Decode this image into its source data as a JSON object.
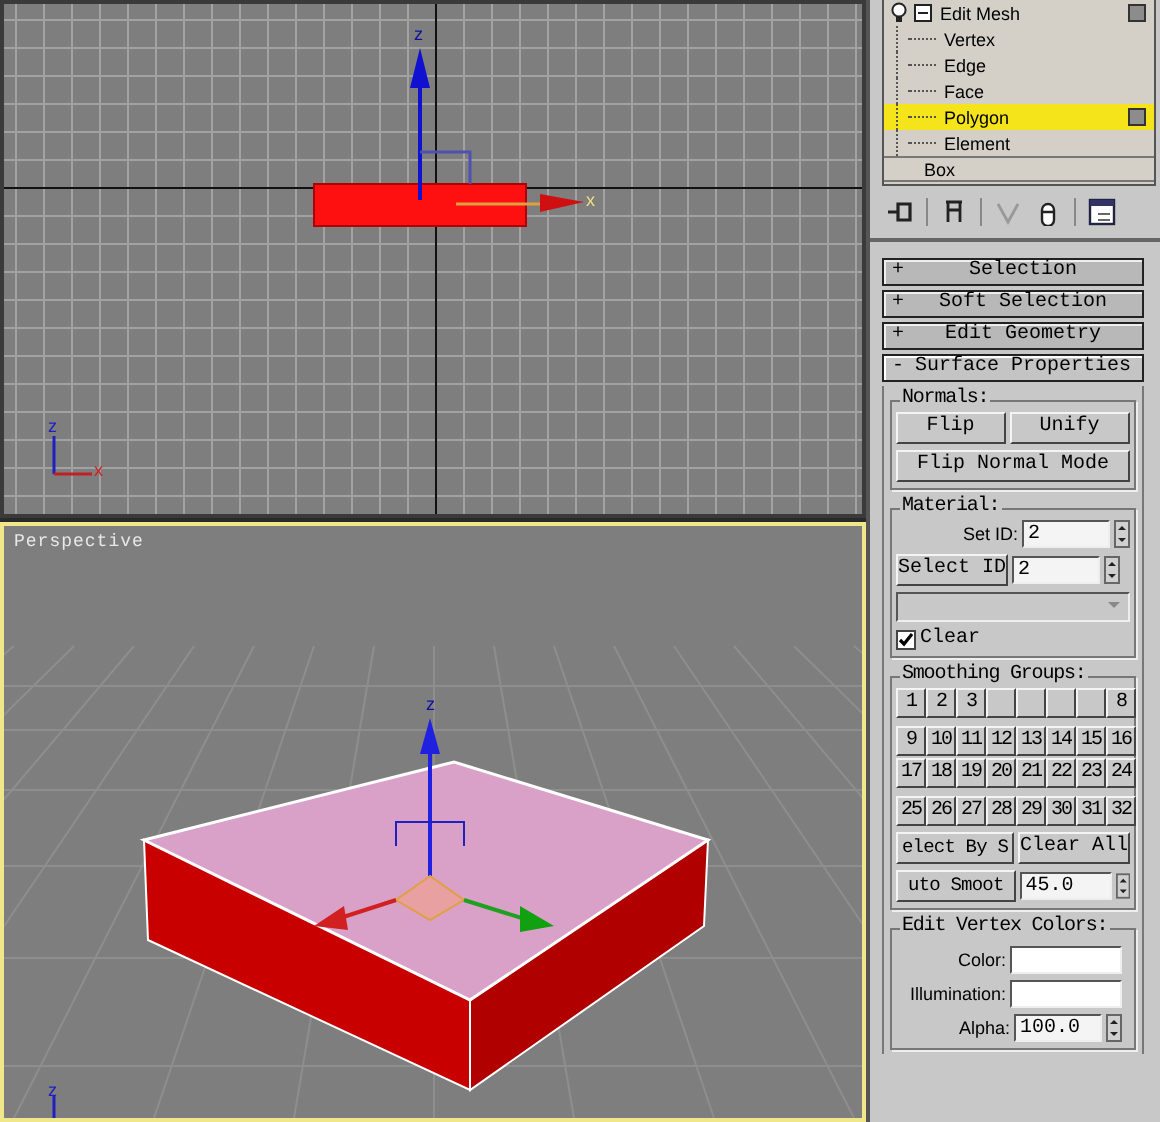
{
  "top_viewport": {
    "active": false,
    "gizmo_labels": {
      "z": "z",
      "x": "x"
    },
    "tripod_labels": {
      "z": "z",
      "x": "x"
    }
  },
  "perspective_viewport": {
    "label": "Perspective",
    "active": true,
    "gizmo_label": "z",
    "tripod_label": "z"
  },
  "modifier_stack": {
    "modifier": {
      "label": "Edit Mesh",
      "expanded": true,
      "sub_objects": [
        {
          "label": "Vertex",
          "selected": false
        },
        {
          "label": "Edge",
          "selected": false
        },
        {
          "label": "Face",
          "selected": false
        },
        {
          "label": "Polygon",
          "selected": true
        },
        {
          "label": "Element",
          "selected": false
        }
      ]
    },
    "base": "Box"
  },
  "rollouts": [
    {
      "sign": "+",
      "title": "Selection",
      "expanded": false
    },
    {
      "sign": "+",
      "title": "Soft Selection",
      "expanded": false
    },
    {
      "sign": "+",
      "title": "Edit Geometry",
      "expanded": false
    },
    {
      "sign": "-",
      "title": "Surface Properties",
      "expanded": true
    }
  ],
  "surface_properties": {
    "normals": {
      "title": "Normals:",
      "buttons": [
        "Flip",
        "Unify"
      ],
      "mode_button": "Flip Normal Mode"
    },
    "material": {
      "title": "Material:",
      "set_id_label": "Set ID:",
      "set_id_value": "2",
      "select_id_button": "Select ID",
      "select_id_value": "2",
      "clear": {
        "label": "Clear",
        "checked": true
      }
    },
    "smoothing_groups": {
      "title": "Smoothing Groups:",
      "groups": [
        {
          "kind": "number",
          "label": "1"
        },
        {
          "kind": "number",
          "label": "2"
        },
        {
          "kind": "number",
          "label": "3"
        },
        {
          "kind": "blank"
        },
        {
          "kind": "blank"
        },
        {
          "kind": "blank"
        },
        {
          "kind": "blank"
        },
        {
          "kind": "number",
          "label": "8"
        },
        {
          "kind": "number",
          "label": "9"
        },
        {
          "kind": "number",
          "label": "10"
        },
        {
          "kind": "number",
          "label": "11"
        },
        {
          "kind": "number",
          "label": "12"
        },
        {
          "kind": "number",
          "label": "13"
        },
        {
          "kind": "number",
          "label": "14"
        },
        {
          "kind": "number",
          "label": "15"
        },
        {
          "kind": "number",
          "label": "16"
        },
        {
          "kind": "number",
          "label": "17"
        },
        {
          "kind": "number",
          "label": "18"
        },
        {
          "kind": "number",
          "label": "19"
        },
        {
          "kind": "number",
          "label": "20"
        },
        {
          "kind": "number",
          "label": "21"
        },
        {
          "kind": "number",
          "label": "22"
        },
        {
          "kind": "number",
          "label": "23"
        },
        {
          "kind": "number",
          "label": "24"
        },
        {
          "kind": "number",
          "label": "25"
        },
        {
          "kind": "number",
          "label": "26"
        },
        {
          "kind": "number",
          "label": "27"
        },
        {
          "kind": "number",
          "label": "28"
        },
        {
          "kind": "number",
          "label": "29"
        },
        {
          "kind": "number",
          "label": "30"
        },
        {
          "kind": "number",
          "label": "31"
        },
        {
          "kind": "number",
          "label": "32"
        }
      ],
      "select_by_button": "elect By S",
      "clear_all_button": "Clear All",
      "auto_smooth_button": "uto Smoot",
      "threshold": "45.0"
    },
    "vertex_colors": {
      "title": "Edit Vertex Colors:",
      "color_label": "Color:",
      "illumination_label": "Illumination:",
      "alpha_label": "Alpha:",
      "alpha_value": "100.0"
    }
  }
}
